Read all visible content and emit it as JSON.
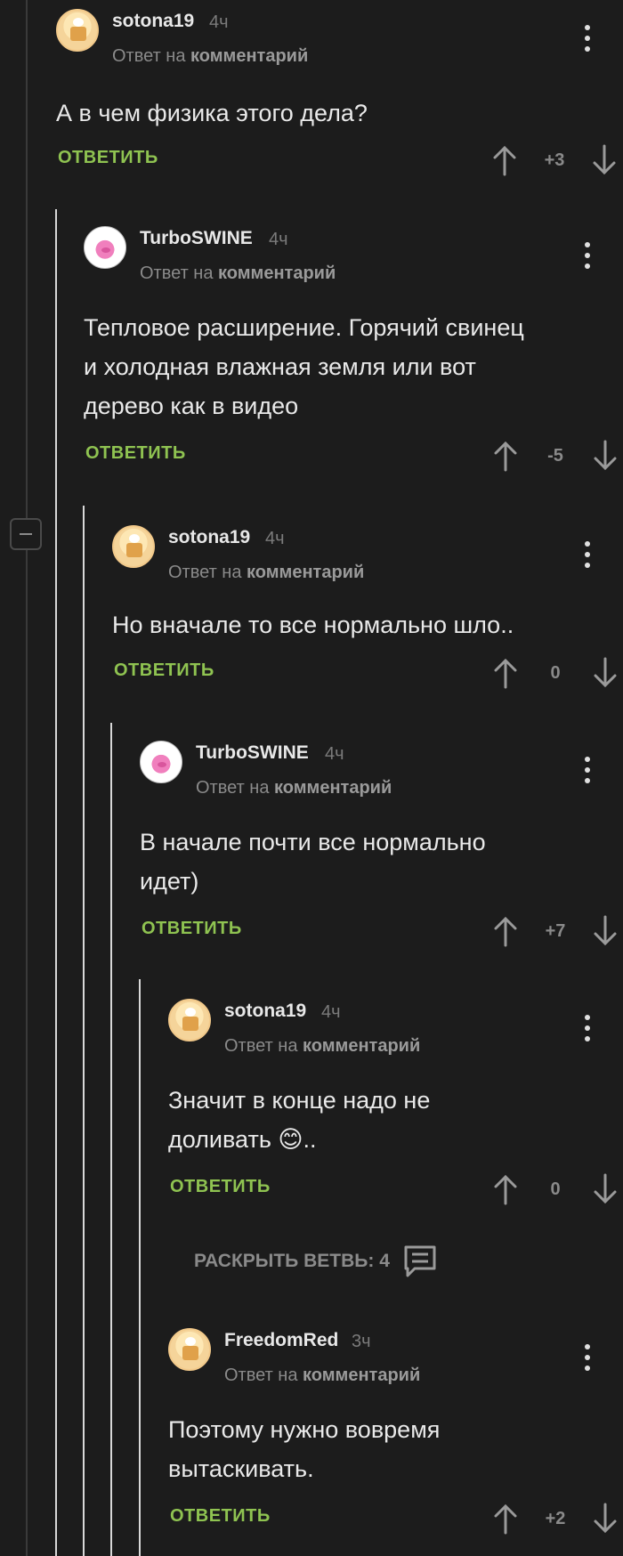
{
  "ui": {
    "reply_prefix": "Ответ на",
    "reply_target": "комментарий",
    "reply_button": "ОТВЕТИТЬ",
    "expand_branch": "РАСКРЫТЬ ВЕТВЬ: 4"
  },
  "colors": {
    "background": "#1c1c1c",
    "reply_green": "#8fc351",
    "muted": "#8a8a8a",
    "thread_active": "#d8d8d8"
  },
  "comments": [
    {
      "user": "sotona19",
      "time": "4ч",
      "avatar": "cake-avatar",
      "text_lines": [
        "А в чем физика этого дела?"
      ],
      "rating": "+3"
    },
    {
      "user": "TurboSWINE",
      "time": "4ч",
      "avatar": "pig-avatar",
      "text_lines": [
        "Тепловое расширение. Горячий свинец",
        "и холодная влажная земля или вот",
        "дерево как в видео"
      ],
      "rating": "-5"
    },
    {
      "user": "sotona19",
      "time": "4ч",
      "avatar": "cake-avatar",
      "text_lines": [
        "Но вначале то все нормально шло.."
      ],
      "rating": "0"
    },
    {
      "user": "TurboSWINE",
      "time": "4ч",
      "avatar": "pig-avatar",
      "text_lines": [
        "В начале почти все нормально",
        "идет)"
      ],
      "rating": "+7"
    },
    {
      "user": "sotona19",
      "time": "4ч",
      "avatar": "cake-avatar",
      "text_lines": [
        "Значит в конце надо не",
        "доливать 😊.."
      ],
      "rating": "0"
    },
    {
      "user": "FreedomRed",
      "time": "3ч",
      "avatar": "cake-avatar",
      "text_lines": [
        "Поэтому нужно вовремя",
        "вытаскивать."
      ],
      "rating": "+2"
    }
  ]
}
